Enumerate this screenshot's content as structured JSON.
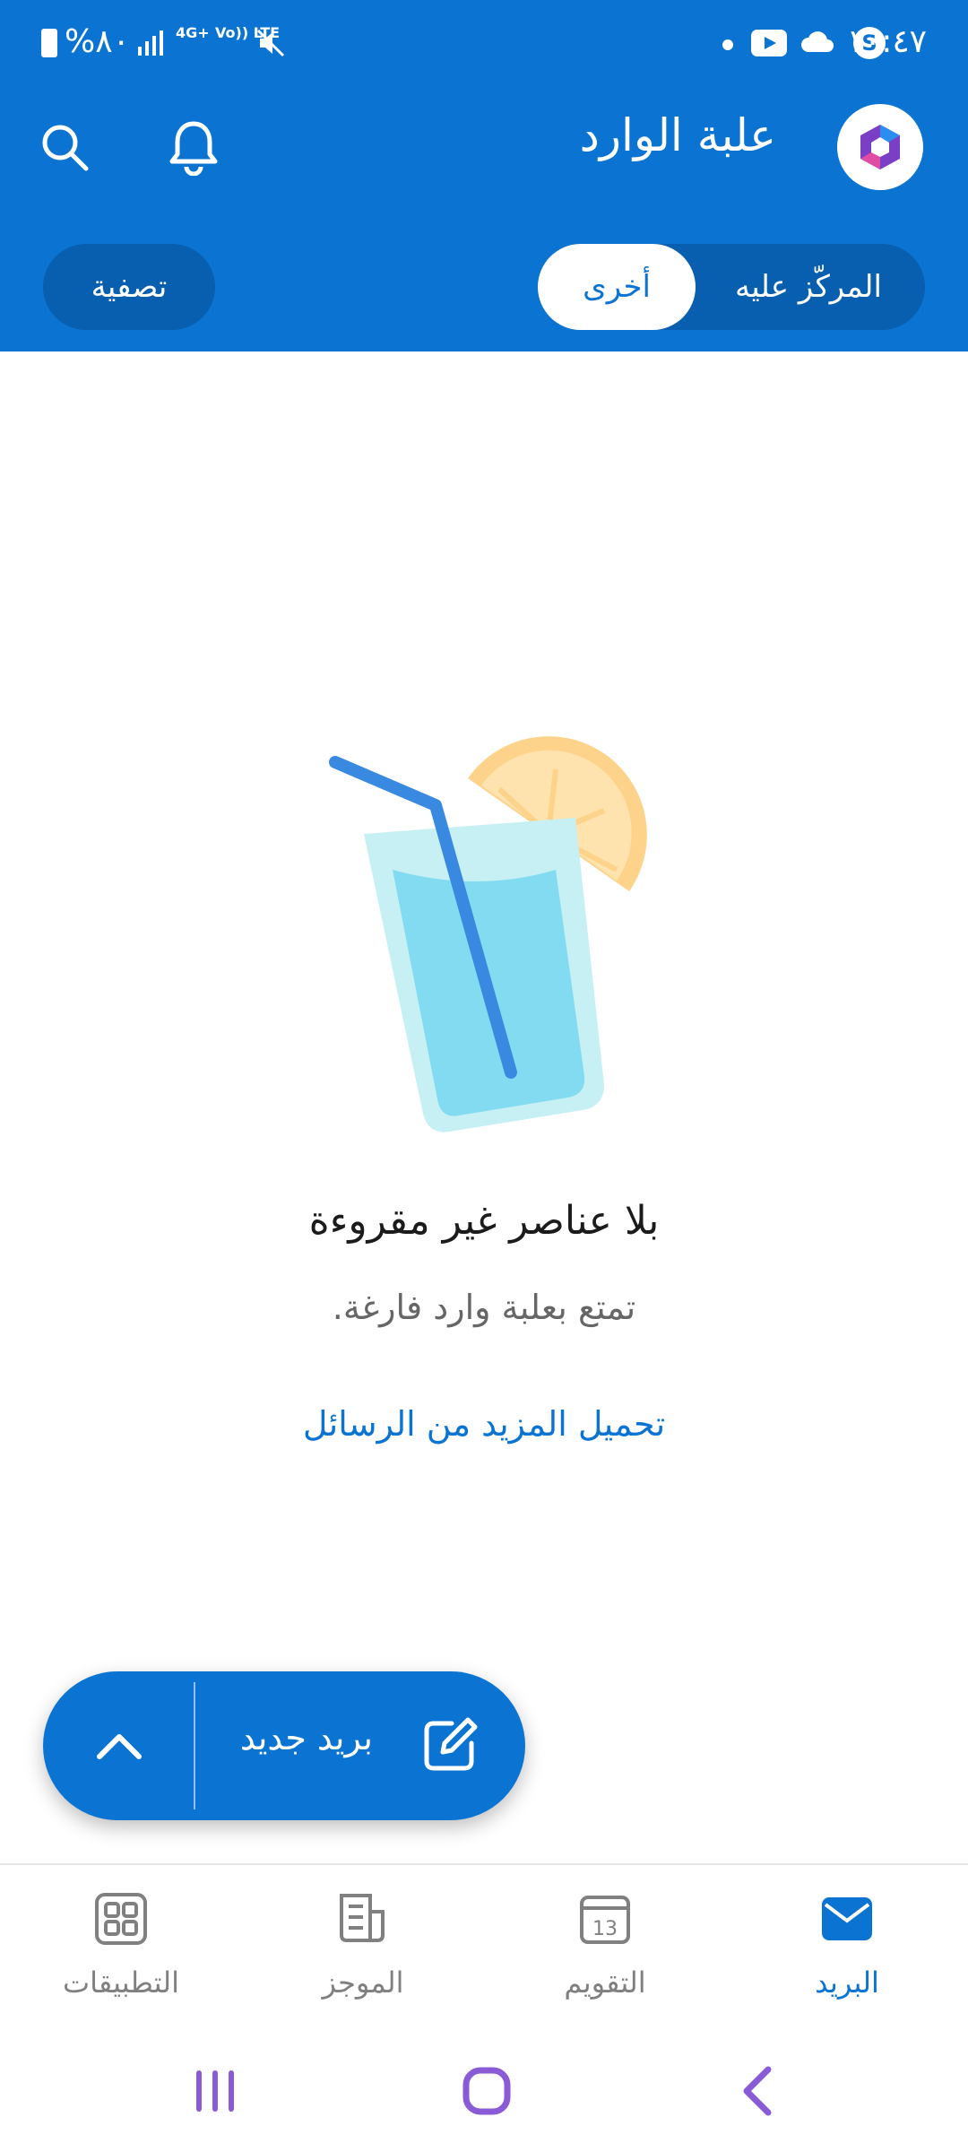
{
  "status_bar": {
    "time": "١٠:٤٧",
    "battery": "%٨٠",
    "network_1": "4G+",
    "network_2": "Vo)) LTE",
    "icons": [
      "youtube-icon",
      "cloud-icon",
      "s-icon",
      "signal-icon",
      "mute-icon",
      "battery-icon"
    ]
  },
  "header": {
    "title": "علبة الوارد",
    "icons": [
      "search-icon",
      "bell-icon",
      "microsoft365-logo"
    ]
  },
  "tabs": {
    "focused_label": "المركّز عليه",
    "other_label": "أخرى",
    "selected": "other"
  },
  "filter": {
    "label": "تصفية"
  },
  "empty_state": {
    "title": "بلا عناصر غير مقروءة",
    "subtitle": "تمتع بعلبة وارد فارغة.",
    "load_more": "تحميل المزيد من الرسائل"
  },
  "fab": {
    "label": "بريد جديد",
    "icons": [
      "compose-icon",
      "chevron-up-icon"
    ]
  },
  "bottom_nav": {
    "items": [
      {
        "label": "البريد",
        "icon": "mail-icon",
        "active": true
      },
      {
        "label": "التقويم",
        "icon": "calendar-icon",
        "calendar_day": "13",
        "active": false
      },
      {
        "label": "الموجز",
        "icon": "feed-icon",
        "active": false
      },
      {
        "label": "التطبيقات",
        "icon": "apps-icon",
        "active": false
      }
    ]
  },
  "colors": {
    "brand_blue": "#0b74d3",
    "brand_blue_dark": "#085fb0",
    "system_nav_purple": "#8a5bd6"
  }
}
